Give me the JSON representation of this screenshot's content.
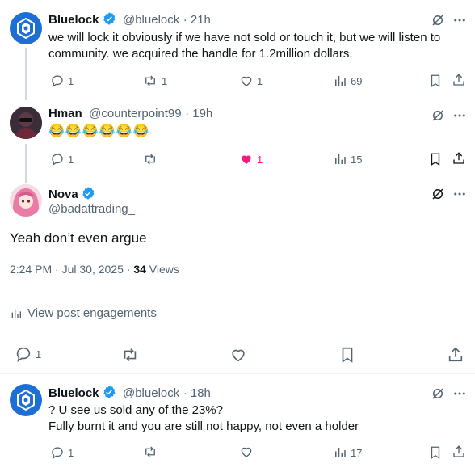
{
  "reply1": {
    "name": "Bluelock",
    "handle": "@bluelock",
    "time": "· 21h",
    "text_line1": "we will lock it obviously if we have not sold or touch it, but we will listen to",
    "text_line2": "community. we acquired the handle for 1.2million dollars.",
    "replies": "1",
    "reposts": "1",
    "likes": "1",
    "views": "69"
  },
  "reply2": {
    "name": "Hman",
    "handle": "@counterpoint99",
    "time": "· 19h",
    "text": "😂😂😂😂😂😂",
    "replies": "1",
    "reposts": "",
    "likes": "1",
    "views": "15"
  },
  "main": {
    "name": "Nova",
    "handle": "@badattrading_",
    "text": "Yeah don’t even argue",
    "timestamp": "2:24 PM · Jul 30, 2025 · ",
    "views_count": "34",
    "views_label": " Views",
    "engagements": "View post engagements",
    "replies": "1"
  },
  "reply3": {
    "name": "Bluelock",
    "handle": "@bluelock",
    "time": "· 18h",
    "text_line1": "? U see us sold any of the 23%?",
    "text_line2": "Fully burnt it and you are still not happy, not even a holder",
    "replies": "1",
    "views": "17"
  },
  "colors": {
    "verified": "#1d9bf0",
    "like_active": "#f91880",
    "bluelock_avatar": "#1d6fd6",
    "muted": "#536471"
  }
}
